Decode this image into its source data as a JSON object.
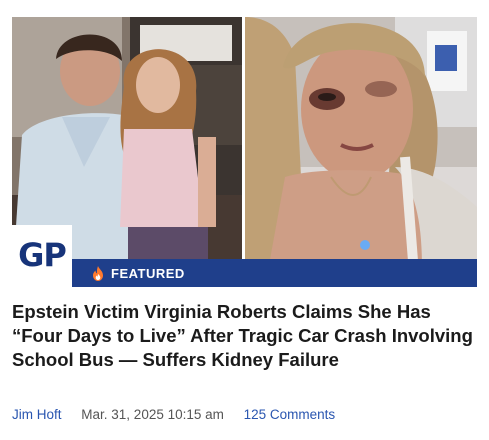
{
  "article": {
    "badge_text": "GP",
    "featured_label": "FEATURED",
    "headline": "Epstein Victim Virginia Roberts Claims She Has “Four Days to Live” After Tragic Car Crash Involving School Bus — Suffers Kidney Failure",
    "author": "Jim Hoft",
    "date": "Mar. 31, 2025 10:15 am",
    "comments": "125 Comments"
  },
  "colors": {
    "featured_bar": "#1f3f8b",
    "badge_text": "#17347a",
    "link": "#2a56b0",
    "headline": "#1b1b1b",
    "flame": "#ff7a2e"
  },
  "icons": {
    "featured": "flame-icon"
  }
}
